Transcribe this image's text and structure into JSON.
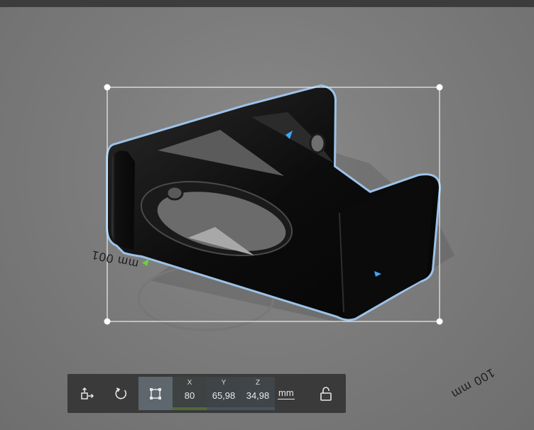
{
  "viewport": {
    "floor_labels": [
      "mm 001",
      "100 mm"
    ]
  },
  "toolbar": {
    "tools": [
      {
        "name": "move",
        "icon": "move-icon",
        "active": false
      },
      {
        "name": "rotate",
        "icon": "rotate-icon",
        "active": false
      },
      {
        "name": "scale",
        "icon": "scale-icon",
        "active": true
      }
    ],
    "x_label": "X",
    "x_value": "80",
    "y_label": "Y",
    "y_value": "65,98",
    "z_label": "Z",
    "z_value": "34,98",
    "unit": "mm",
    "lock_icon": "unlock-icon"
  },
  "colors": {
    "selection_outline": "#9cc2e8",
    "active_tool": "#5d676d",
    "toolbar_bg": "#3a3a3a",
    "x_axis": "#4e6b3a"
  }
}
